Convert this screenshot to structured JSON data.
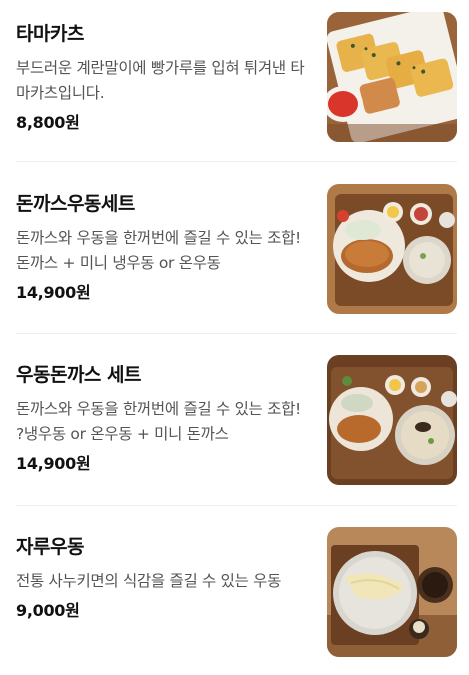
{
  "menu": {
    "items": [
      {
        "name": "타마카츠",
        "description": "부드러운 계란말이에 빵가루를 입혀 튀겨낸 타마카츠입니다.",
        "price": "8,800원",
        "image_alt": "타마카츠 사진"
      },
      {
        "name": "돈까스우동세트",
        "description": "돈까스와 우동을 한꺼번에 즐길 수 있는 조합! 돈까스 + 미니 냉우동 or 온우동",
        "price": "14,900원",
        "image_alt": "돈까스우동세트 사진"
      },
      {
        "name": "우동돈까스 세트",
        "description": "돈까스와 우동을 한꺼번에 즐길 수 있는 조합! ?냉우동 or 온우동 + 미니 돈까스",
        "price": "14,900원",
        "image_alt": "우동돈까스 세트 사진"
      },
      {
        "name": "자루우동",
        "description": "전통 사누키면의 식감을 즐길 수 있는 우동",
        "price": "9,000원",
        "image_alt": "자루우동 사진"
      }
    ]
  },
  "colors": {
    "name": "#111111",
    "description": "#555555",
    "price": "#111111",
    "divider": "#eeeeee"
  }
}
